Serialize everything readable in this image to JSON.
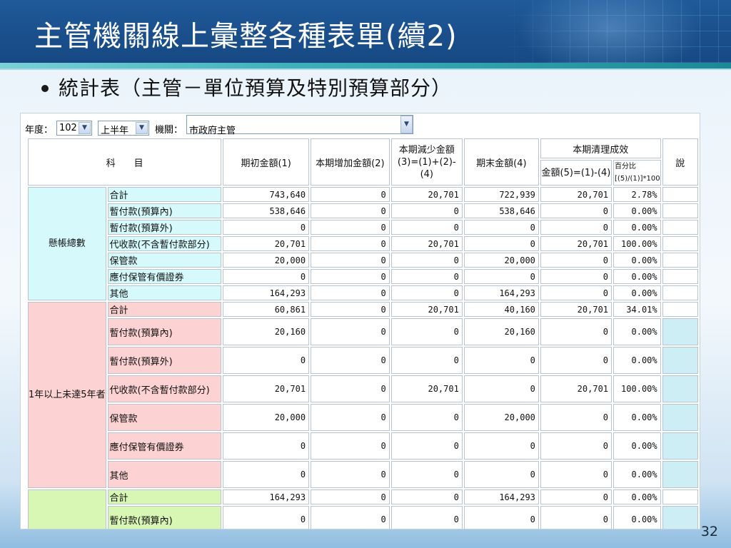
{
  "slide": {
    "title": "主管機關線上彙整各種表單(續2)",
    "bullet": "統計表（主管－單位預算及特別預算部分）",
    "page_number": "32"
  },
  "filters": {
    "year_label": "年度：",
    "year_value": "102",
    "half_value": "上半年",
    "agency_label": "機關：",
    "agency_value": "市政府主管"
  },
  "table": {
    "headers": {
      "subject": "科　　目",
      "begin": "期初金額(1)",
      "increase": "本期增加金額(2)",
      "decrease": "本期減少金額(3)=(1)+(2)-(4)",
      "end": "期末金額(4)",
      "clear_group": "本期清理成效",
      "clear_amount": "金額(5)=(1)-(4)",
      "clear_pct": "百分比[(5)/(1)]*100",
      "note": "說"
    },
    "groups": [
      {
        "name": "懸帳總數",
        "rows": [
          {
            "label": "合計",
            "begin": "743,640",
            "inc": "0",
            "dec": "20,701",
            "end": "722,939",
            "amt": "20,701",
            "pct": "2.78%"
          },
          {
            "label": "暫付款(預算內)",
            "begin": "538,646",
            "inc": "0",
            "dec": "0",
            "end": "538,646",
            "amt": "0",
            "pct": "0.00%"
          },
          {
            "label": "暫付款(預算外)",
            "begin": "0",
            "inc": "0",
            "dec": "0",
            "end": "0",
            "amt": "0",
            "pct": "0.00%"
          },
          {
            "label": "代收款(不含暫付款部分)",
            "begin": "20,701",
            "inc": "0",
            "dec": "20,701",
            "end": "0",
            "amt": "20,701",
            "pct": "100.00%"
          },
          {
            "label": "保管款",
            "begin": "20,000",
            "inc": "0",
            "dec": "0",
            "end": "20,000",
            "amt": "0",
            "pct": "0.00%"
          },
          {
            "label": "應付保管有價證券",
            "begin": "0",
            "inc": "0",
            "dec": "0",
            "end": "0",
            "amt": "0",
            "pct": "0.00%"
          },
          {
            "label": "其他",
            "begin": "164,293",
            "inc": "0",
            "dec": "0",
            "end": "164,293",
            "amt": "0",
            "pct": "0.00%"
          }
        ]
      },
      {
        "name": "1年以上未達5年者",
        "rows": [
          {
            "label": "合計",
            "begin": "60,861",
            "inc": "0",
            "dec": "20,701",
            "end": "40,160",
            "amt": "20,701",
            "pct": "34.01%"
          },
          {
            "label": "暫付款(預算內)",
            "begin": "20,160",
            "inc": "0",
            "dec": "0",
            "end": "20,160",
            "amt": "0",
            "pct": "0.00%"
          },
          {
            "label": "暫付款(預算外)",
            "begin": "0",
            "inc": "0",
            "dec": "0",
            "end": "0",
            "amt": "0",
            "pct": "0.00%"
          },
          {
            "label": "代收款(不含暫付款部分)",
            "begin": "20,701",
            "inc": "0",
            "dec": "20,701",
            "end": "0",
            "amt": "20,701",
            "pct": "100.00%"
          },
          {
            "label": "保管款",
            "begin": "20,000",
            "inc": "0",
            "dec": "0",
            "end": "20,000",
            "amt": "0",
            "pct": "0.00%"
          },
          {
            "label": "應付保管有價證券",
            "begin": "0",
            "inc": "0",
            "dec": "0",
            "end": "0",
            "amt": "0",
            "pct": "0.00%"
          },
          {
            "label": "其他",
            "begin": "0",
            "inc": "0",
            "dec": "0",
            "end": "0",
            "amt": "0",
            "pct": "0.00%"
          }
        ]
      },
      {
        "name": "",
        "rows": [
          {
            "label": "合計",
            "begin": "164,293",
            "inc": "0",
            "dec": "0",
            "end": "164,293",
            "amt": "0",
            "pct": "0.00%"
          },
          {
            "label": "暫付款(預算內)",
            "begin": "0",
            "inc": "0",
            "dec": "0",
            "end": "0",
            "amt": "0",
            "pct": "0.00%"
          }
        ]
      }
    ]
  }
}
